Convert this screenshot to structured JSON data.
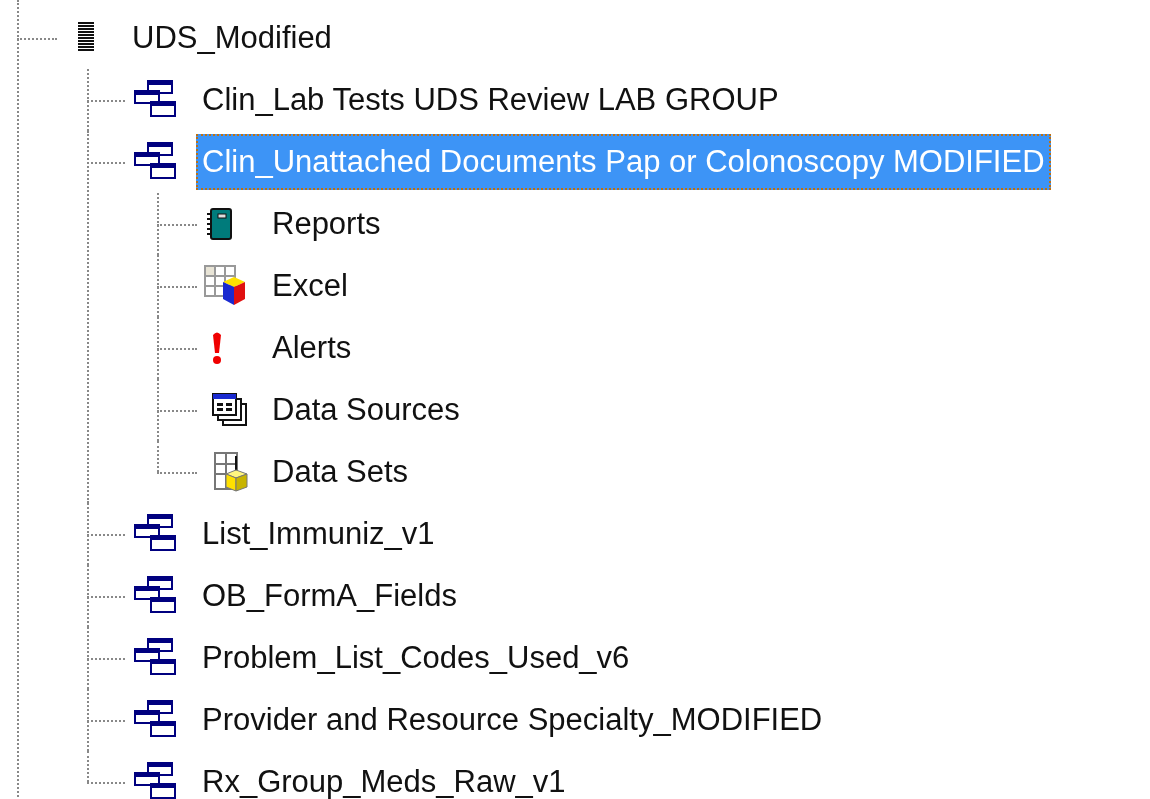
{
  "tree": {
    "items": [
      {
        "label": "UDS_Modified",
        "kind": "folder",
        "selected": false,
        "children": [
          {
            "label": "Clin_Lab Tests UDS Review LAB GROUP",
            "kind": "group",
            "selected": false
          },
          {
            "label": "Clin_Unattached Documents Pap or Colonoscopy MODIFIED",
            "kind": "group",
            "selected": true,
            "children": [
              {
                "label": "Reports",
                "kind": "reports",
                "selected": false
              },
              {
                "label": "Excel",
                "kind": "excel",
                "selected": false
              },
              {
                "label": "Alerts",
                "kind": "alerts",
                "selected": false
              },
              {
                "label": "Data Sources",
                "kind": "sources",
                "selected": false
              },
              {
                "label": "Data Sets",
                "kind": "sets",
                "selected": false
              }
            ]
          },
          {
            "label": "List_Immuniz_v1",
            "kind": "group",
            "selected": false
          },
          {
            "label": "OB_FormA_Fields",
            "kind": "group",
            "selected": false
          },
          {
            "label": "Problem_List_Codes_Used_v6",
            "kind": "group",
            "selected": false
          },
          {
            "label": "Provider and Resource Specialty_MODIFIED",
            "kind": "group",
            "selected": false
          },
          {
            "label": "Rx_Group_Meds_Raw_v1",
            "kind": "group",
            "selected": false
          }
        ]
      }
    ]
  }
}
